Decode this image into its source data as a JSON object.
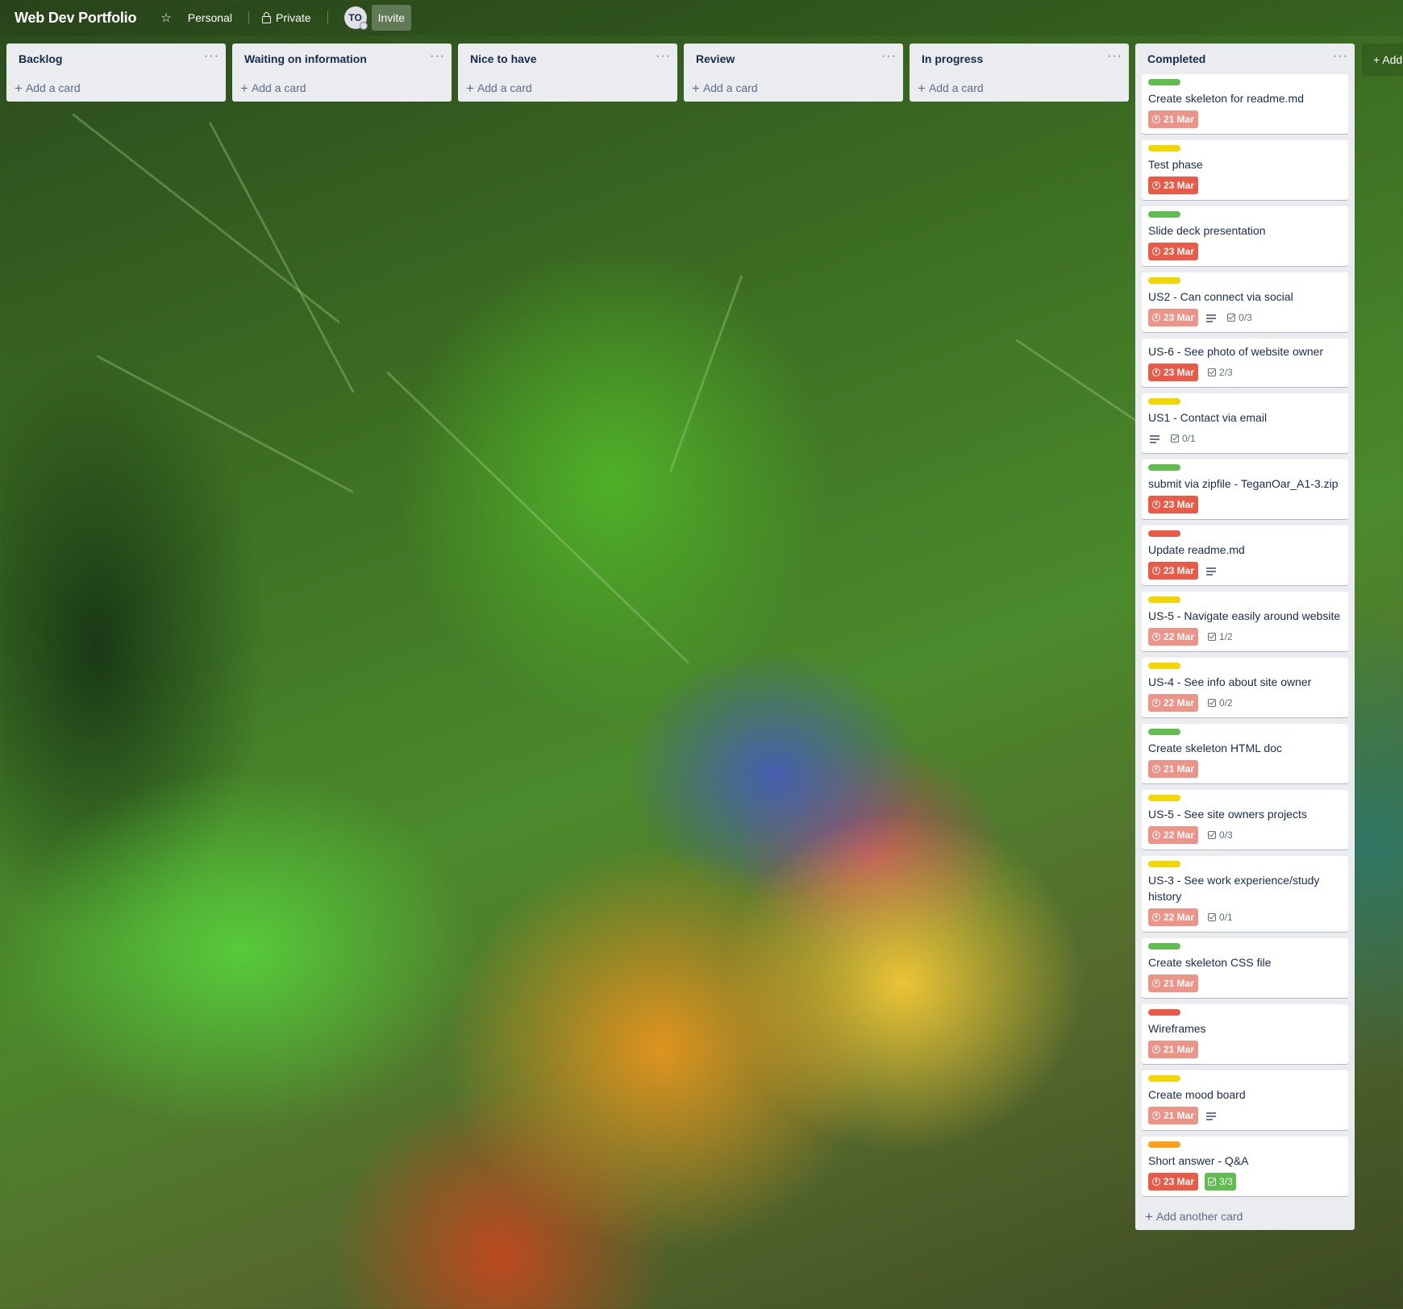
{
  "header": {
    "board_title": "Web Dev Portfolio",
    "team_label": "Personal",
    "visibility_label": "Private",
    "avatar_initials": "TO",
    "invite_label": "Invite"
  },
  "add_card_label": "Add a card",
  "add_another_card_label": "Add another card",
  "add_list_label": "+ Add",
  "label_colors": {
    "green": "#61bd4f",
    "yellow": "#f2d600",
    "red": "#eb5a46",
    "orange": "#ff9f1a"
  },
  "lists": [
    {
      "title": "Backlog"
    },
    {
      "title": "Waiting on information"
    },
    {
      "title": "Nice to have"
    },
    {
      "title": "Review"
    },
    {
      "title": "In progress"
    },
    {
      "title": "Completed",
      "cards": [
        {
          "label": "green",
          "title": "Create skeleton for readme.md",
          "due": "21 Mar",
          "due_style": "overdue",
          "description": false,
          "checklist": null
        },
        {
          "label": "yellow",
          "title": "Test phase",
          "due": "23 Mar",
          "due_style": "red",
          "description": false,
          "checklist": null
        },
        {
          "label": "green",
          "title": "Slide deck presentation",
          "due": "23 Mar",
          "due_style": "red",
          "description": false,
          "checklist": null
        },
        {
          "label": "yellow",
          "title": "US2 - Can connect via social",
          "due": "23 Mar",
          "due_style": "overdue",
          "description": true,
          "checklist": "0/3"
        },
        {
          "label": null,
          "title": "US-6 - See photo of website owner",
          "due": "23 Mar",
          "due_style": "red",
          "description": false,
          "checklist": "2/3"
        },
        {
          "label": "yellow",
          "title": "US1 - Contact via email",
          "due": null,
          "due_style": null,
          "description": true,
          "checklist": "0/1"
        },
        {
          "label": "green",
          "title": "submit via zipfile - TeganOar_A1-3.zip",
          "due": "23 Mar",
          "due_style": "red",
          "description": false,
          "checklist": null
        },
        {
          "label": "red",
          "title": "Update readme.md",
          "due": "23 Mar",
          "due_style": "red",
          "description": true,
          "checklist": null
        },
        {
          "label": "yellow",
          "title": "US-5 - Navigate easily around website",
          "due": "22 Mar",
          "due_style": "overdue",
          "description": false,
          "checklist": "1/2"
        },
        {
          "label": "yellow",
          "title": "US-4 - See info about site owner",
          "due": "22 Mar",
          "due_style": "overdue",
          "description": false,
          "checklist": "0/2"
        },
        {
          "label": "green",
          "title": "Create skeleton HTML doc",
          "due": "21 Mar",
          "due_style": "overdue",
          "description": false,
          "checklist": null
        },
        {
          "label": "yellow",
          "title": "US-5 - See site owners projects",
          "due": "22 Mar",
          "due_style": "overdue",
          "description": false,
          "checklist": "0/3"
        },
        {
          "label": "yellow",
          "title": "US-3 - See work experience/study history",
          "due": "22 Mar",
          "due_style": "overdue",
          "description": false,
          "checklist": "0/1"
        },
        {
          "label": "green",
          "title": "Create skeleton CSS file",
          "due": "21 Mar",
          "due_style": "overdue",
          "description": false,
          "checklist": null
        },
        {
          "label": "red",
          "title": "Wireframes",
          "due": "21 Mar",
          "due_style": "overdue",
          "description": false,
          "checklist": null
        },
        {
          "label": "yellow",
          "title": "Create mood board",
          "due": "21 Mar",
          "due_style": "overdue",
          "description": true,
          "checklist": null
        },
        {
          "label": "orange",
          "title": "Short answer - Q&A",
          "due": "23 Mar",
          "due_style": "red",
          "description": false,
          "checklist": "3/3",
          "checklist_complete": true
        }
      ]
    }
  ]
}
